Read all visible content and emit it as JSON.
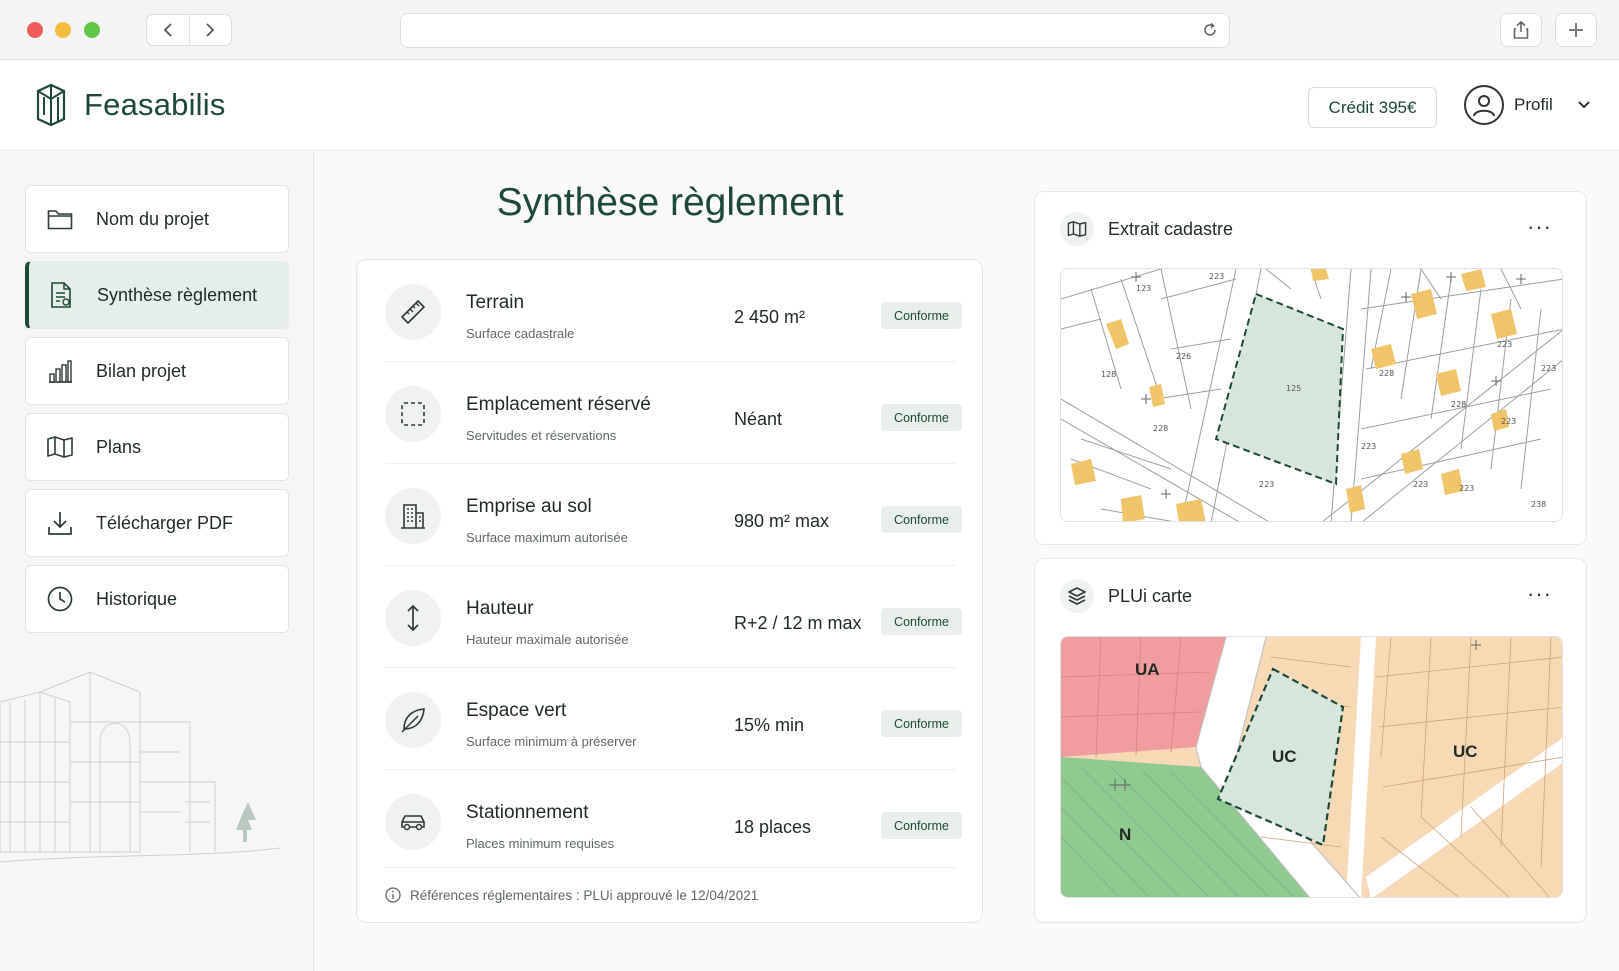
{
  "app": {
    "brand": "Feasabilis"
  },
  "header": {
    "credit_label": "Crédit 395€",
    "profile_label": "Profil"
  },
  "sidebar": {
    "items": [
      {
        "label": "Nom du projet",
        "icon": "folder-icon"
      },
      {
        "label": "Synthèse règlement",
        "icon": "document-icon"
      },
      {
        "label": "Bilan projet",
        "icon": "bar-chart-icon"
      },
      {
        "label": "Plans",
        "icon": "map-icon"
      },
      {
        "label": "Télécharger PDF",
        "icon": "download-icon"
      },
      {
        "label": "Historique",
        "icon": "clock-icon"
      }
    ],
    "active_index": 1
  },
  "main": {
    "title": "Synthèse règlement",
    "rows": [
      {
        "title": "Terrain",
        "subtitle": "Surface cadastrale",
        "value": "2 450 m²",
        "status": "Conforme",
        "icon": "ruler-icon"
      },
      {
        "title": "Emplacement réservé",
        "subtitle": "Servitudes et réservations",
        "value": "Néant",
        "status": "Conforme",
        "icon": "dashed-square-icon"
      },
      {
        "title": "Emprise au sol",
        "subtitle": "Surface maximum autorisée",
        "value": "980 m² max",
        "status": "Conforme",
        "icon": "building-icon"
      },
      {
        "title": "Hauteur",
        "subtitle": "Hauteur maximale autorisée",
        "value": "R+2 / 12 m max",
        "status": "Conforme",
        "icon": "vertical-arrows-icon"
      },
      {
        "title": "Espace vert",
        "subtitle": "Surface minimum à préserver",
        "value": "15% min",
        "status": "Conforme",
        "icon": "leaf-icon"
      },
      {
        "title": "Stationnement",
        "subtitle": "Places minimum requises",
        "value": "18 places",
        "status": "Conforme",
        "icon": "car-icon"
      }
    ],
    "footnote": "Références réglementaires : PLUi approuvé le 12/04/2021"
  },
  "cadastre": {
    "title": "Extrait cadastre",
    "more": "···",
    "parcel_labels": [
      "123",
      "223",
      "226",
      "125",
      "128",
      "228",
      "228",
      "223",
      "228",
      "223",
      "223",
      "223",
      "223",
      "223",
      "223",
      "238"
    ]
  },
  "plui": {
    "title": "PLUi carte",
    "more": "···",
    "zones": [
      "UA",
      "UC",
      "UC",
      "N"
    ]
  },
  "colors": {
    "brand_green": "#1c4a36",
    "badge_bg": "#e8efea",
    "parcel_fill": "#d7e6da",
    "zone_ua": "#ef9d9d",
    "zone_uc": "#f8d9b5",
    "zone_n": "#8fca8f"
  }
}
